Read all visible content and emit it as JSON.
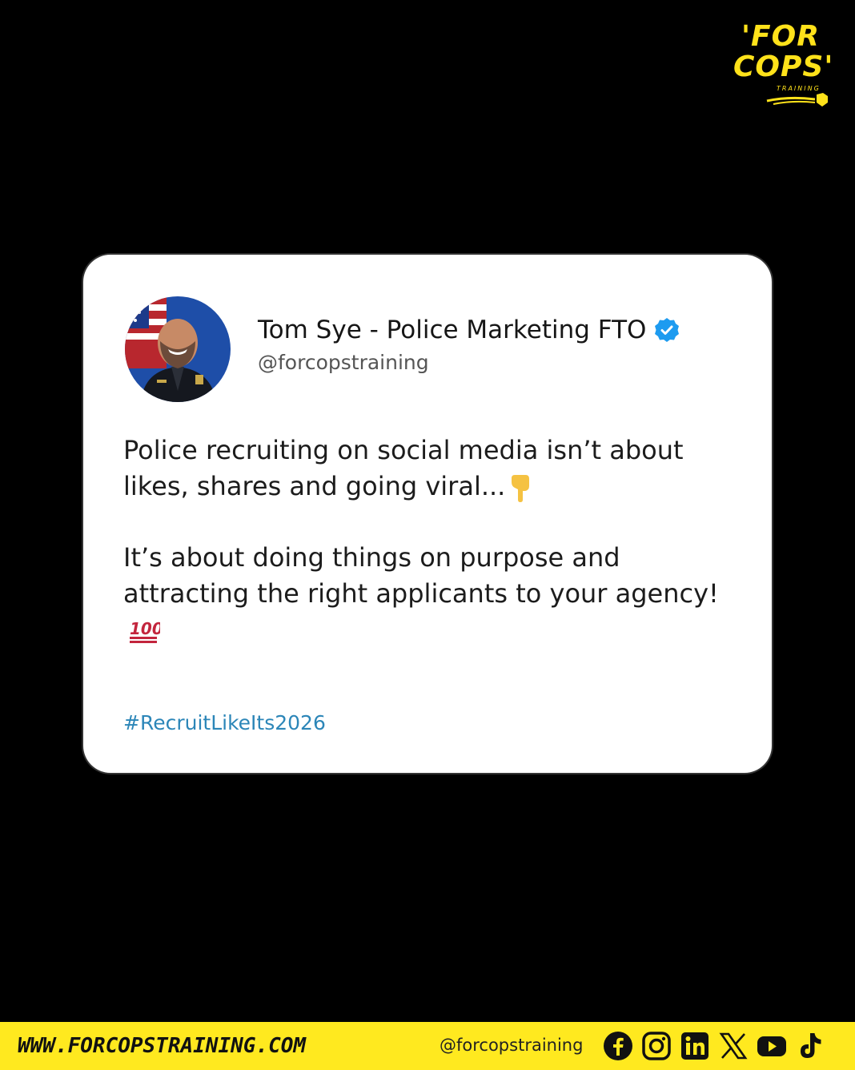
{
  "brand": {
    "logo_line1": "'FOR",
    "logo_line2": "COPS'",
    "logo_sub": "TRAINING",
    "accent": "#ffe21a"
  },
  "post": {
    "author_name": "Tom Sye - Police Marketing FTO",
    "handle": "@forcopstraining",
    "verified_color": "#1d9bf0",
    "paragraph1": "Police recruiting on social media isn’t about likes, shares and going viral...",
    "paragraph1_emoji": "pointing-down-icon",
    "paragraph2": "It’s about doing things on purpose and attracting the right applicants to your agency!",
    "paragraph2_emoji": "hundred-points-icon",
    "hashtag": "#RecruitLikeIts2026",
    "hashtag_color": "#2c86b8"
  },
  "footer": {
    "website": "WWW.FORCOPSTRAINING.COM",
    "handle": "@forcopstraining",
    "background": "#ffe91f",
    "socials": [
      "facebook-icon",
      "instagram-icon",
      "linkedin-icon",
      "x-icon",
      "youtube-icon",
      "tiktok-icon"
    ]
  }
}
